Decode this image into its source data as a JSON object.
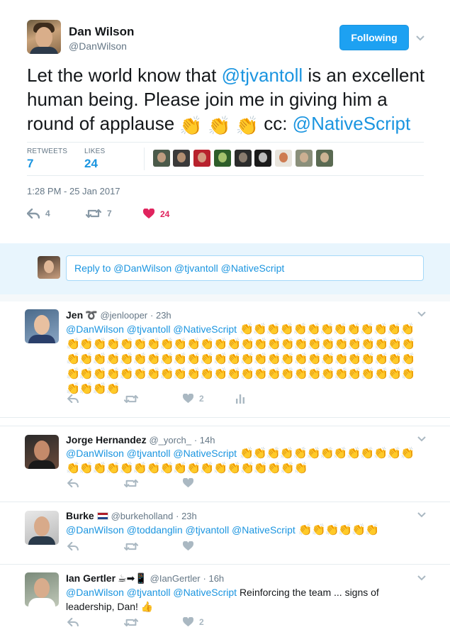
{
  "tweet": {
    "author_name": "Dan Wilson",
    "author_handle": "@DanWilson",
    "follow_label": "Following",
    "text_parts": {
      "p1": "Let the world know that ",
      "m1": "@tjvantoll",
      "p2": " is an excellent human being. Please join me in giving him a round of applause ",
      "p3": " cc: ",
      "m2": "@NativeScript"
    },
    "clap": "👏",
    "retweets_label": "RETWEETS",
    "retweets_value": "7",
    "likes_label": "LIKES",
    "likes_value": "24",
    "timestamp": "1:28 PM - 25 Jan 2017",
    "actions": {
      "reply_count": "4",
      "retweet_count": "7",
      "like_count": "24"
    },
    "like_color": "#e0245e",
    "accent_color": "#1da1f2"
  },
  "reply_box": {
    "text": "Reply to @DanWilson @tjvantoll @NativeScript"
  },
  "replies": [
    {
      "name": "Jen",
      "icon": "➰",
      "handle": "@jenlooper",
      "time": "· 23h",
      "mentions": "@DanWilson @tjvantoll @NativeScript ",
      "text": "",
      "claps": "👏👏👏👏👏👏👏👏👏👏👏👏👏👏👏👏👏👏👏👏👏👏👏👏👏👏👏👏👏👏👏👏👏👏👏👏👏👏👏👏👏👏👏👏👏👏👏👏👏👏👏👏👏👏👏👏👏👏👏👏👏👏👏👏👏👏👏👏👏👏👏👏👏👏👏👏👏👏👏👏👏👏👏👏👏👏👏👏👏👏👏👏👏👏👏",
      "like_count": "2"
    },
    {
      "name": "Jorge Hernandez",
      "icon": "",
      "handle": "@_yorch_",
      "time": "· 14h",
      "mentions": "@DanWilson @tjvantoll @NativeScript ",
      "text": "",
      "claps": "👏👏👏👏👏👏👏👏👏👏👏👏👏👏👏👏👏👏👏👏👏👏👏👏👏👏👏👏👏👏👏",
      "like_count": ""
    },
    {
      "name": "Burke",
      "icon": "",
      "handle": "@burkeholland",
      "time": "· 23h",
      "mentions": "@DanWilson @toddanglin @tjvantoll @NativeScript ",
      "text": "",
      "claps": "👏👏👏👏👏👏",
      "like_count": ""
    },
    {
      "name": "Ian Gertler",
      "icon": "☕➡📱",
      "handle": "@IanGertler",
      "time": "· 16h",
      "mentions": "@DanWilson @tjvantoll @NativeScript ",
      "text": "Reinforcing the team ... signs of leadership, Dan! 👍",
      "claps": "",
      "like_count": "2"
    }
  ]
}
